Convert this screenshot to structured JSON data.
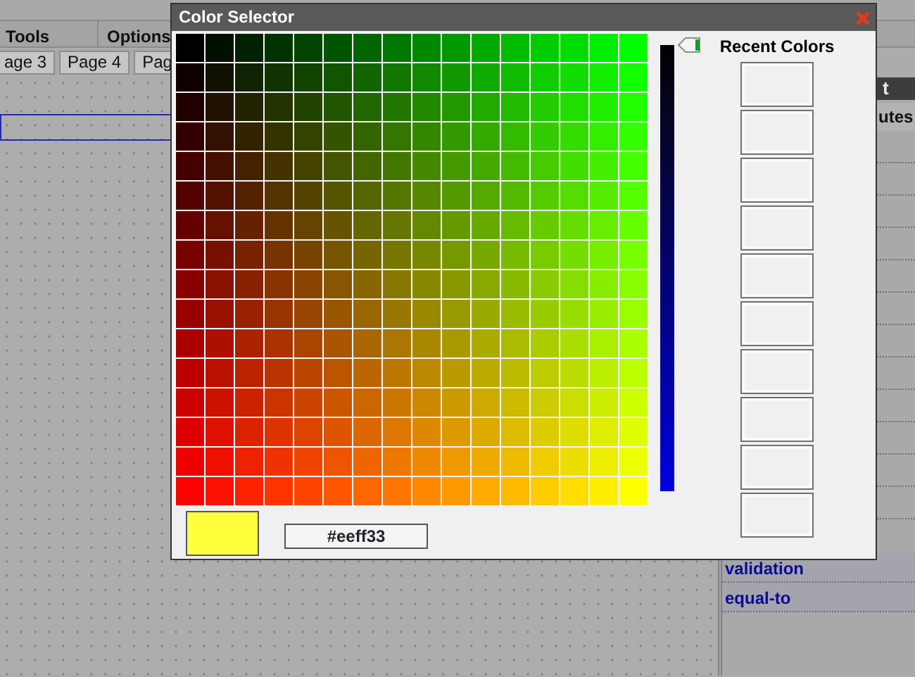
{
  "menu": [
    {
      "label": "Tools"
    },
    {
      "label": "Options"
    }
  ],
  "page_tabs": [
    {
      "label": "age 3"
    },
    {
      "label": "Page 4"
    },
    {
      "label": "Pag"
    }
  ],
  "canvas": {
    "selected_field": true
  },
  "panel": {
    "header": "t",
    "section": "utes",
    "items": [
      {
        "label": "validation"
      },
      {
        "label": "equal-to"
      }
    ]
  },
  "dialog": {
    "title": "Color Selector",
    "brightness": {
      "level": 0
    },
    "recent_title": "Recent Colors",
    "preview": {
      "color": "#ffff3c"
    },
    "value": "#eeff33"
  }
}
